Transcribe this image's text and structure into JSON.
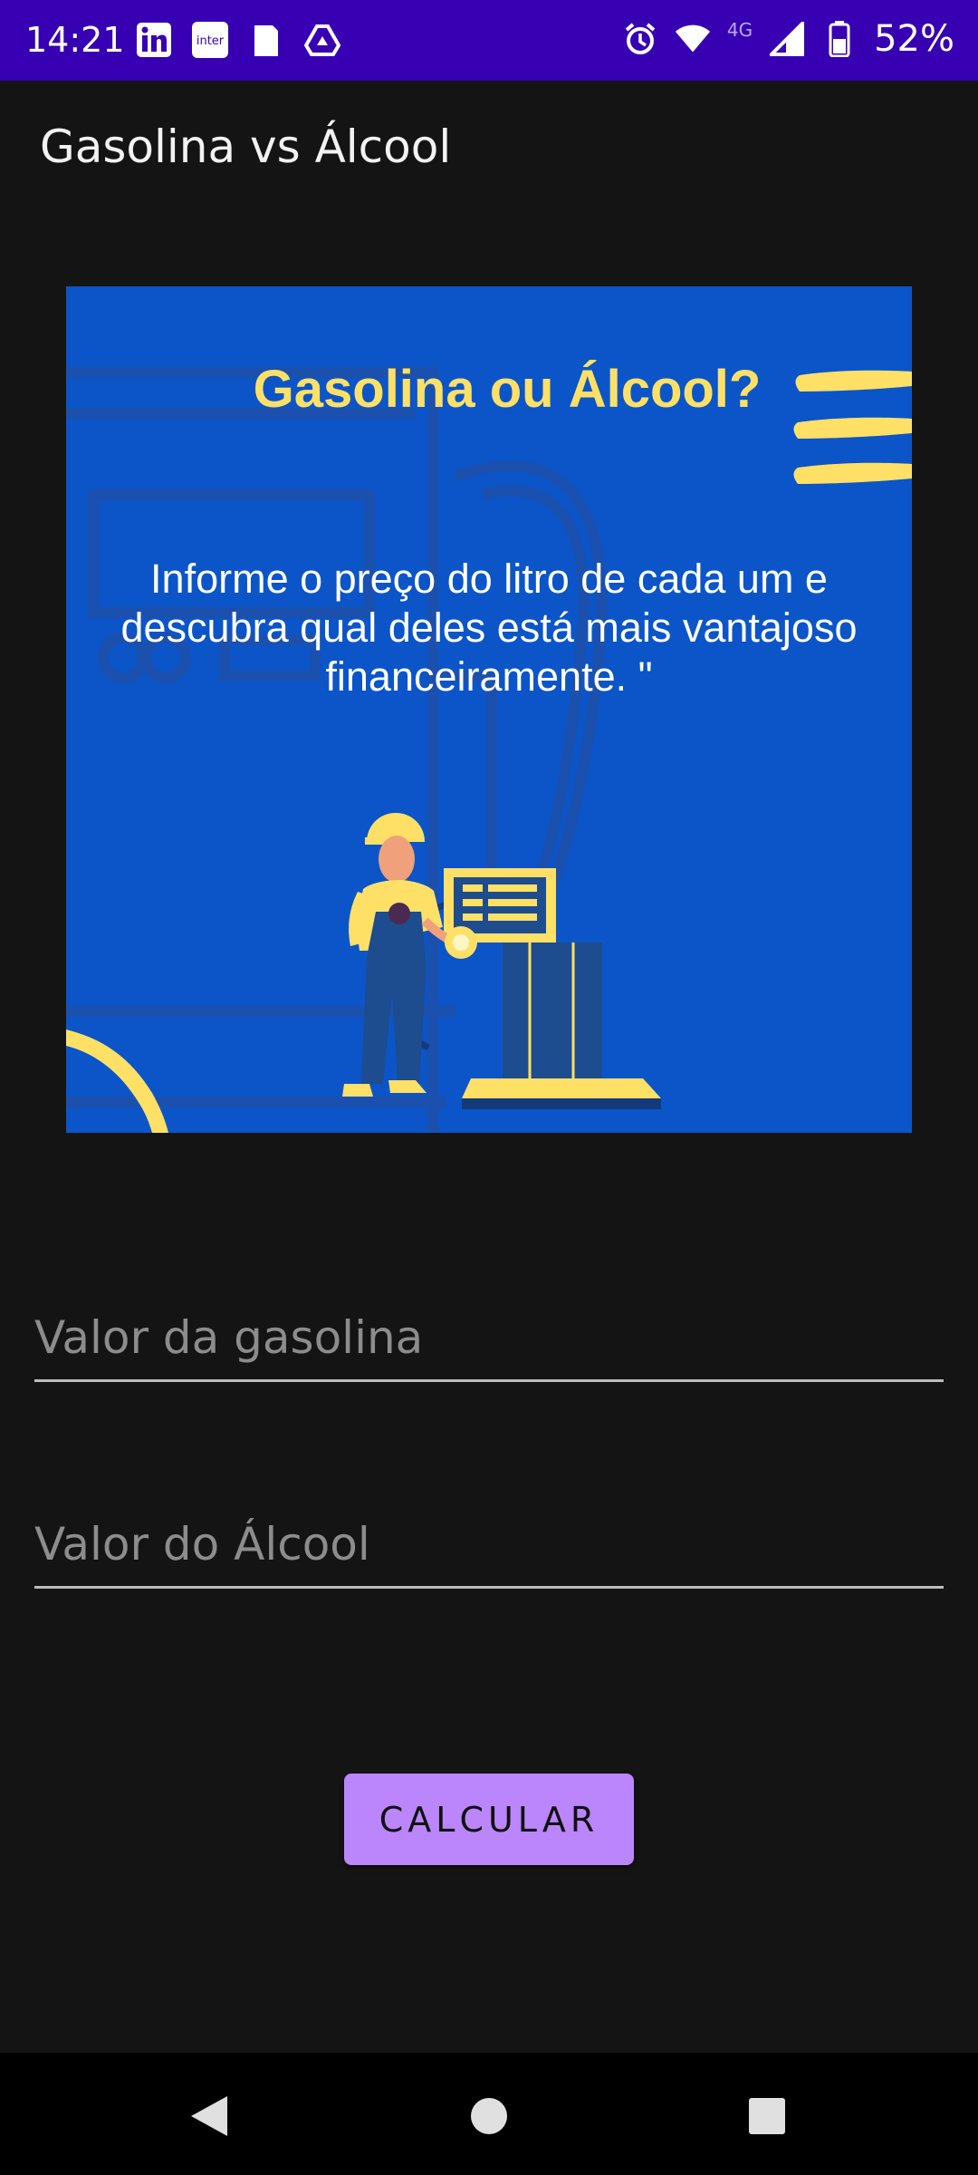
{
  "status_bar": {
    "time": "14:21",
    "network_label": "4G",
    "battery_percent": "52%",
    "left_icons": [
      "linkedin-icon",
      "inter-app-icon",
      "document-icon",
      "drive-icon"
    ],
    "inter_label": "inter",
    "right_icons": [
      "alarm-icon",
      "wifi-icon",
      "signal-icon",
      "battery-icon"
    ]
  },
  "app_bar": {
    "title": "Gasolina vs Álcool"
  },
  "banner": {
    "title": "Gasolina ou Álcool?",
    "text": "Informe o  preço do litro de cada um e descubra qual deles está mais vantajoso financeiramente. \"",
    "colors": {
      "background": "#0b55c9",
      "accent": "#ffe066"
    }
  },
  "form": {
    "gasoline_placeholder": "Valor da gasolina",
    "alcohol_placeholder": "Valor do Álcool",
    "gasoline_value": "",
    "alcohol_value": "",
    "button_label": "CALCULAR"
  },
  "nav_bar": {
    "icons": [
      "back-icon",
      "home-icon",
      "recents-icon"
    ]
  },
  "colors": {
    "status_bar": "#3700b3",
    "background": "#141414",
    "button": "#bb86fc"
  }
}
